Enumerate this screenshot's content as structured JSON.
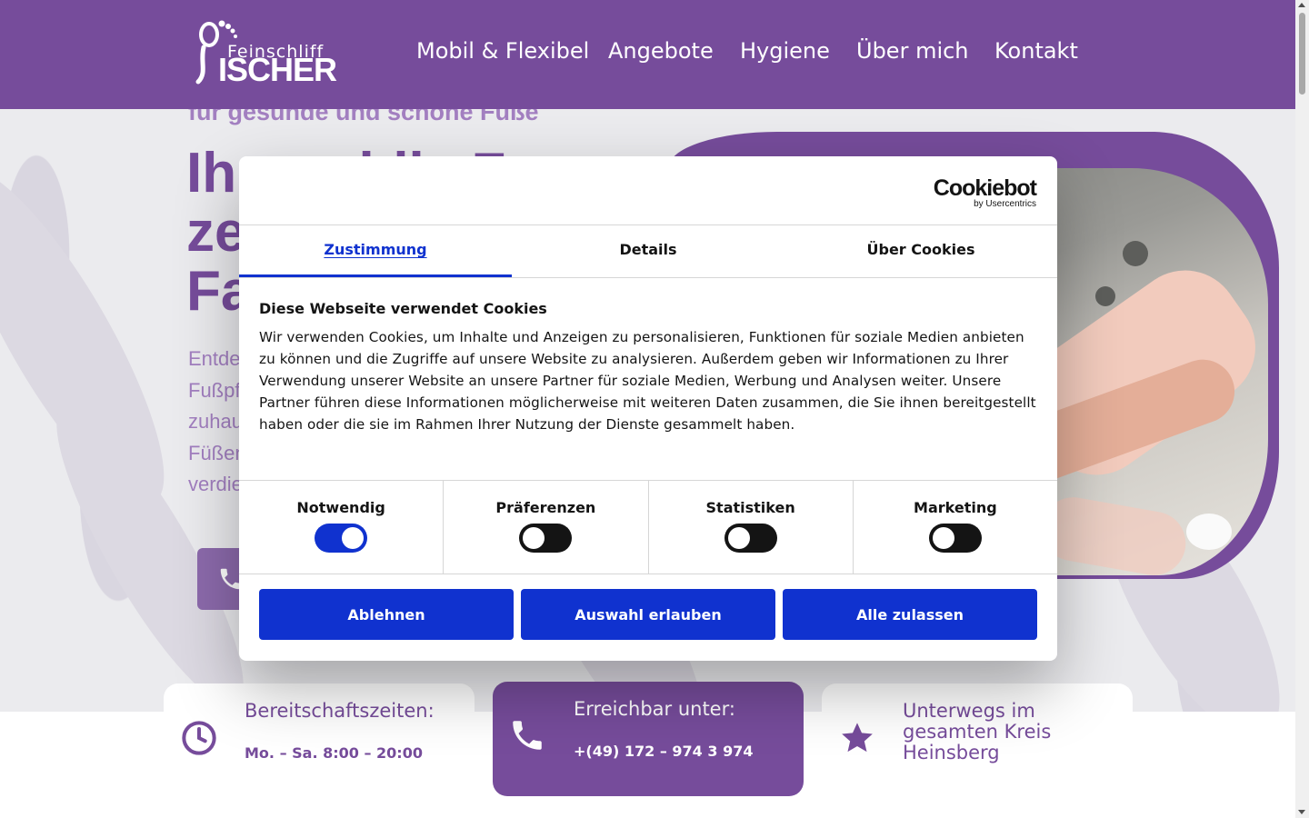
{
  "site": {
    "logo": {
      "top": "Feinschliff",
      "bottom": "ISCHER"
    },
    "nav": [
      "Mobil & Flexibel",
      "Angebote",
      "Hygiene",
      "Über mich",
      "Kontakt"
    ],
    "tagline": "für gesunde und schöne Füße",
    "headline": [
      "Ihr mobile F",
      "zertifizierte",
      "Fa"
    ],
    "subtext": [
      "Entdecken",
      "Fußpflege",
      "zuhause",
      "Füßen",
      "verdienen"
    ],
    "info_cards": [
      {
        "title": "Bereitschaftszeiten:",
        "sub": "Mo. – Sa. 8:00 – 20:00",
        "icon": "clock-icon"
      },
      {
        "title": "Erreichbar unter:",
        "sub": "+(49) 172 – 974 3 974",
        "icon": "phone-icon"
      },
      {
        "title": "Unterwegs im gesamten Kreis Heinsberg",
        "sub": "",
        "icon": "star-icon"
      }
    ],
    "colors": {
      "brand": "#764c9b",
      "brand_light": "#a27fc0"
    }
  },
  "cookie_dialog": {
    "brand": "Cookiebot",
    "brand_by": "by Usercentrics",
    "tabs": [
      "Zustimmung",
      "Details",
      "Über Cookies"
    ],
    "active_tab": "Zustimmung",
    "title": "Diese Webseite verwendet Cookies",
    "text": "Wir verwenden Cookies, um Inhalte und Anzeigen zu personalisieren, Funktionen für soziale Medien anbieten zu können und die Zugriffe auf unsere Website zu analysieren. Außerdem geben wir Informationen zu Ihrer Verwendung unserer Website an unsere Partner für soziale Medien, Werbung und Analysen weiter. Unsere Partner führen diese Informationen möglicherweise mit weiteren Daten zusammen, die Sie ihnen bereitgestellt haben oder die sie im Rahmen Ihrer Nutzung der Dienste gesammelt haben.",
    "toggles": [
      {
        "label": "Notwendig",
        "on": true
      },
      {
        "label": "Präferenzen",
        "on": false
      },
      {
        "label": "Statistiken",
        "on": false
      },
      {
        "label": "Marketing",
        "on": false
      }
    ],
    "buttons": [
      "Ablehnen",
      "Auswahl erlauben",
      "Alle zulassen"
    ],
    "colors": {
      "accent": "#1032cf"
    }
  }
}
